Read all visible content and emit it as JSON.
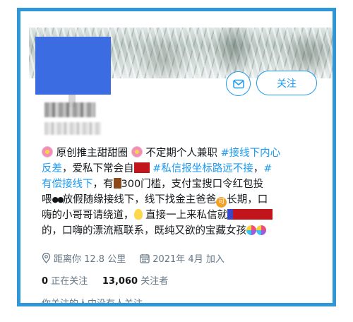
{
  "colors": {
    "accent": "#1d9bf0",
    "frame": "#2f97d8",
    "redaction_red": "#c2141b",
    "avatar_blue": "#3b6ce2"
  },
  "profile": {
    "follow_label": "关注",
    "message_icon": "envelope-icon",
    "bio": {
      "l1_a": "原创推主甜甜圈",
      "l1_b": "不定期个人兼职",
      "l1_tag": "#接线下内心",
      "l2_tag": "反差",
      "l2_a": "，爱私下常会自",
      "l2_tag2": "#私信报坐标路远不接",
      "l2_b": "，",
      "l2_tag3": "#",
      "l3_tag": "有偿接线下",
      "l3_a": "，有",
      "l3_b": "300门槛，支付宝搜口令红包投",
      "l4_a": "喂",
      "l4_b": "放假随缘接线下，线下找金主爸爸",
      "l4_c": "长期，口",
      "l5_a": "嗨的小哥哥请绕道，",
      "l5_b": "直接一上来私信就",
      "l6_a": "的，口嗨的漂流瓶联系，既纯又欲的宝藏女孩"
    },
    "location": "距离你 12.8 公里",
    "joined": "2021年 4月 加入",
    "following_count": "0",
    "following_label": "正在关注",
    "followers_count": "13,060",
    "followers_label": "关注者",
    "no_mutual": "你关注的人中没有人关注"
  }
}
